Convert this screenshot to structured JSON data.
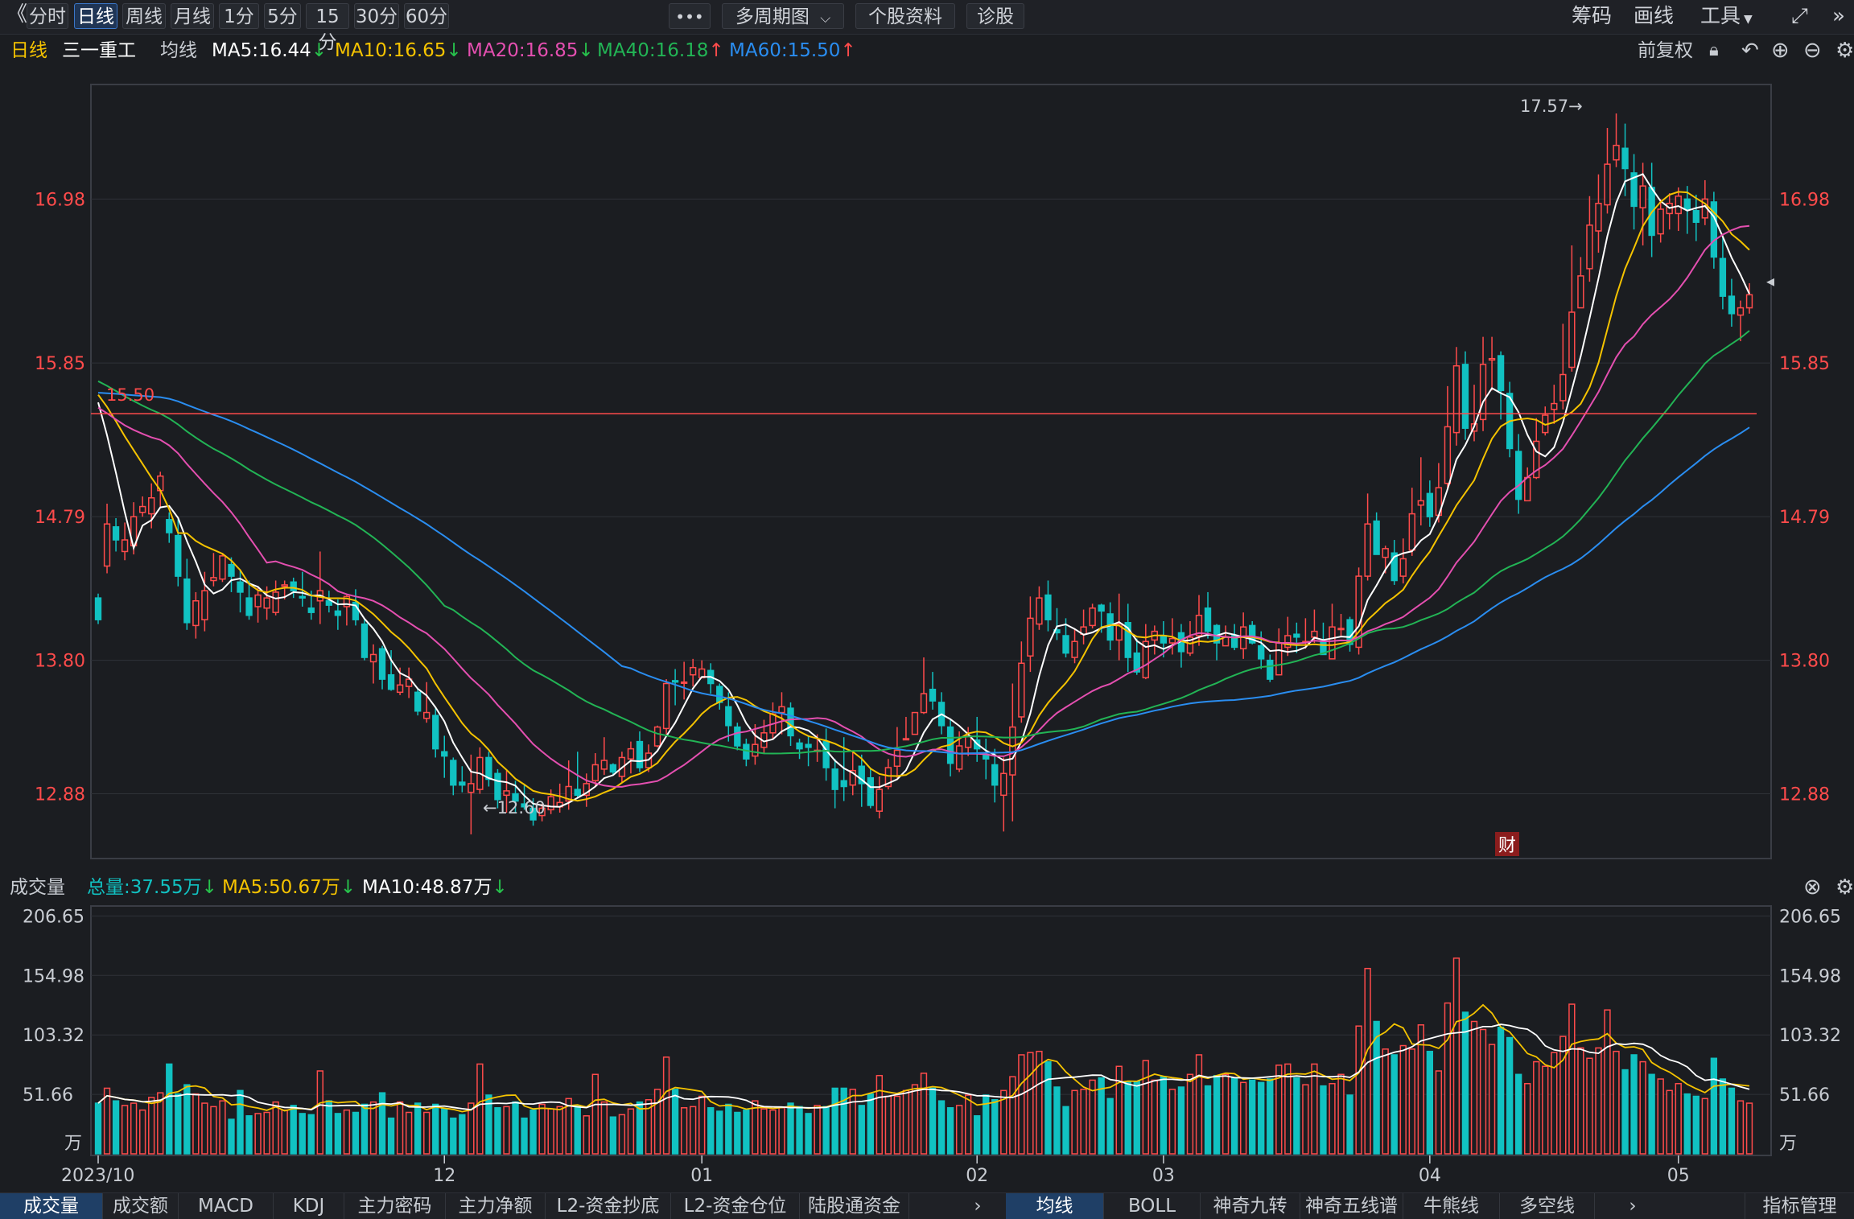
{
  "toolbar": {
    "back_glyph": "《",
    "periods": [
      "分时",
      "日线",
      "周线",
      "月线",
      "1分",
      "5分",
      "15分",
      "30分",
      "60分"
    ],
    "active_period": 1,
    "more_label": "•••",
    "multi_period_label": "多周期图",
    "stock_info_label": "个股资料",
    "diagnose_label": "诊股",
    "right_links": [
      "筹码",
      "画线",
      "工具"
    ]
  },
  "ma_bar": {
    "period_label": "日线",
    "stock_name": "三一重工",
    "avg_label": "均线",
    "items": [
      {
        "text": "MA5:16.44",
        "arrow": "↓",
        "color": "#ffffff",
        "arrow_color": "#27c24c"
      },
      {
        "text": "MA10:16.65",
        "arrow": "↓",
        "color": "#f5c300",
        "arrow_color": "#27c24c"
      },
      {
        "text": "MA20:16.85",
        "arrow": "↓",
        "color": "#e44fb0",
        "arrow_color": "#27c24c"
      },
      {
        "text": "MA40:16.18",
        "arrow": "↑",
        "color": "#22b455",
        "arrow_color": "#ff4b4b"
      },
      {
        "text": "MA60:15.50",
        "arrow": "↑",
        "color": "#2a8df0",
        "arrow_color": "#ff4b4b"
      }
    ],
    "adjust_label": "前复权"
  },
  "price_chart": {
    "y_ticks": [
      "16.98",
      "15.85",
      "14.79",
      "13.80",
      "12.88"
    ],
    "hline_label": "15.50",
    "high_label": "17.57→",
    "low_label": "←12.60",
    "cai_badge": "财"
  },
  "volume_bar": {
    "title": "成交量",
    "total": "总量:37.55万",
    "ma5": "MA5:50.67万",
    "ma10": "MA10:48.87万",
    "y_ticks": [
      "206.65",
      "154.98",
      "103.32",
      "51.66"
    ],
    "unit": "万"
  },
  "x_labels": [
    "2023/10",
    "12",
    "01",
    "02",
    "03",
    "04",
    "05"
  ],
  "bottom_tabs_left": [
    "成交量",
    "成交额",
    "MACD",
    "KDJ",
    "主力密码",
    "主力净额",
    "L2-资金抄底",
    "L2-资金仓位",
    "陆股通资金"
  ],
  "bottom_tabs_right": [
    "均线",
    "BOLL",
    "神奇九转",
    "神奇五线谱",
    "牛熊线",
    "多空线"
  ],
  "indicator_manage": "指标管理",
  "colors": {
    "up": "#ff4b4b",
    "down": "#11c2c2",
    "ma5": "#ffffff",
    "ma10": "#f5c300",
    "ma20": "#e44fb0",
    "ma40": "#22b455",
    "ma60": "#2a8df0"
  },
  "chart_data": {
    "type": "candlestick",
    "price_ylim": [
      12.0,
      17.95
    ],
    "volume_ylim": [
      0,
      216
    ],
    "reference_line": 15.5,
    "candles": [
      [
        14.23,
        14.08,
        14.26,
        14.05,
        44
      ],
      [
        14.45,
        14.74,
        14.88,
        14.4,
        57
      ],
      [
        14.72,
        14.63,
        14.78,
        14.55,
        46
      ],
      [
        14.55,
        14.63,
        14.75,
        14.49,
        42
      ],
      [
        14.59,
        14.79,
        14.89,
        14.53,
        44
      ],
      [
        14.82,
        14.86,
        14.93,
        14.79,
        38
      ],
      [
        14.81,
        14.92,
        15.02,
        14.71,
        49
      ],
      [
        14.97,
        15.07,
        15.1,
        14.86,
        53
      ],
      [
        14.77,
        14.68,
        14.82,
        14.61,
        78
      ],
      [
        14.66,
        14.38,
        14.78,
        14.31,
        52
      ],
      [
        14.36,
        14.06,
        14.5,
        14.01,
        60
      ],
      [
        14.04,
        14.21,
        14.27,
        13.95,
        52
      ],
      [
        14.08,
        14.28,
        14.41,
        14.0,
        44
      ],
      [
        14.35,
        14.37,
        14.54,
        14.31,
        41
      ],
      [
        14.36,
        14.52,
        14.54,
        14.34,
        46
      ],
      [
        14.46,
        14.38,
        14.51,
        14.27,
        30
      ],
      [
        14.34,
        14.27,
        14.42,
        14.13,
        55
      ],
      [
        14.23,
        14.11,
        14.35,
        14.08,
        33
      ],
      [
        14.17,
        14.25,
        14.31,
        14.06,
        35
      ],
      [
        14.16,
        14.23,
        14.31,
        14.08,
        36
      ],
      [
        14.13,
        14.27,
        14.35,
        14.11,
        45
      ],
      [
        14.31,
        14.32,
        14.35,
        14.22,
        38
      ],
      [
        14.34,
        14.28,
        14.37,
        14.23,
        42
      ],
      [
        14.24,
        14.23,
        14.41,
        14.17,
        35
      ],
      [
        14.16,
        14.13,
        14.28,
        14.08,
        34
      ],
      [
        14.21,
        14.28,
        14.55,
        14.05,
        72
      ],
      [
        14.21,
        14.18,
        14.28,
        14.13,
        46
      ],
      [
        14.14,
        14.11,
        14.22,
        14.01,
        35
      ],
      [
        14.17,
        14.24,
        14.25,
        14.04,
        38
      ],
      [
        14.2,
        14.08,
        14.29,
        14.04,
        36
      ],
      [
        14.05,
        13.82,
        14.08,
        13.8,
        43
      ],
      [
        13.79,
        13.84,
        13.91,
        13.64,
        45
      ],
      [
        13.88,
        13.67,
        13.9,
        13.6,
        53
      ],
      [
        13.7,
        13.6,
        13.87,
        13.59,
        31
      ],
      [
        13.58,
        13.63,
        13.75,
        13.56,
        45
      ],
      [
        13.62,
        13.67,
        13.75,
        13.54,
        36
      ],
      [
        13.58,
        13.45,
        13.61,
        13.42,
        44
      ],
      [
        13.4,
        13.44,
        13.65,
        13.37,
        36
      ],
      [
        13.42,
        13.19,
        13.47,
        13.13,
        43
      ],
      [
        13.17,
        13.14,
        13.28,
        12.99,
        39
      ],
      [
        13.11,
        12.94,
        13.13,
        12.87,
        31
      ],
      [
        12.96,
        12.94,
        13.07,
        12.89,
        34
      ],
      [
        12.89,
        12.95,
        13.15,
        12.6,
        44
      ],
      [
        12.91,
        13.13,
        13.2,
        12.88,
        78
      ],
      [
        13.13,
        12.98,
        13.17,
        12.93,
        51
      ],
      [
        13.02,
        12.84,
        13.05,
        12.78,
        40
      ],
      [
        12.87,
        12.9,
        13.04,
        12.75,
        41
      ],
      [
        12.88,
        12.83,
        12.97,
        12.75,
        45
      ],
      [
        12.81,
        12.79,
        12.94,
        12.77,
        31
      ],
      [
        12.78,
        12.7,
        12.85,
        12.66,
        38
      ],
      [
        12.73,
        12.78,
        12.81,
        12.69,
        43
      ],
      [
        12.77,
        12.86,
        12.91,
        12.74,
        39
      ],
      [
        12.79,
        12.82,
        12.95,
        12.75,
        41
      ],
      [
        12.83,
        12.93,
        13.11,
        12.77,
        48
      ],
      [
        12.91,
        12.87,
        13.17,
        12.85,
        42
      ],
      [
        12.87,
        12.95,
        13.02,
        12.79,
        33
      ],
      [
        12.97,
        13.08,
        13.16,
        12.93,
        69
      ],
      [
        13.05,
        13.11,
        13.27,
        13.01,
        45
      ],
      [
        13.08,
        13.03,
        13.09,
        13.01,
        32
      ],
      [
        13.0,
        13.13,
        13.17,
        12.96,
        34
      ],
      [
        13.12,
        13.19,
        13.24,
        13.02,
        39
      ],
      [
        13.24,
        13.06,
        13.31,
        13.03,
        45
      ],
      [
        13.06,
        13.16,
        13.22,
        13.03,
        47
      ],
      [
        13.21,
        13.34,
        13.35,
        13.2,
        56
      ],
      [
        13.33,
        13.64,
        13.67,
        13.29,
        84
      ],
      [
        13.66,
        13.65,
        13.74,
        13.49,
        56
      ],
      [
        13.65,
        13.65,
        13.79,
        13.53,
        40
      ],
      [
        13.7,
        13.75,
        13.81,
        13.62,
        41
      ],
      [
        13.68,
        13.74,
        13.8,
        13.69,
        50
      ],
      [
        13.73,
        13.64,
        13.78,
        13.57,
        40
      ],
      [
        13.62,
        13.51,
        13.64,
        13.46,
        37
      ],
      [
        13.48,
        13.35,
        13.58,
        13.24,
        43
      ],
      [
        13.34,
        13.21,
        13.37,
        13.18,
        36
      ],
      [
        13.22,
        13.12,
        13.26,
        13.07,
        38
      ],
      [
        13.14,
        13.22,
        13.36,
        13.08,
        46
      ],
      [
        13.2,
        13.3,
        13.39,
        13.16,
        39
      ],
      [
        13.3,
        13.43,
        13.51,
        13.26,
        38
      ],
      [
        13.44,
        13.48,
        13.58,
        13.29,
        40
      ],
      [
        13.47,
        13.28,
        13.51,
        13.21,
        44
      ],
      [
        13.23,
        13.19,
        13.26,
        13.12,
        41
      ],
      [
        13.22,
        13.2,
        13.28,
        13.07,
        35
      ],
      [
        13.18,
        13.18,
        13.29,
        13.1,
        42
      ],
      [
        13.24,
        13.06,
        13.33,
        12.97,
        41
      ],
      [
        13.05,
        12.91,
        13.12,
        12.78,
        57
      ],
      [
        12.97,
        12.93,
        13.27,
        12.83,
        57
      ],
      [
        12.94,
        13.04,
        13.17,
        12.87,
        56
      ],
      [
        13.07,
        12.95,
        13.15,
        12.79,
        42
      ],
      [
        12.99,
        12.8,
        13.06,
        12.78,
        52
      ],
      [
        12.76,
        12.91,
        13.0,
        12.71,
        68
      ],
      [
        12.93,
        13.06,
        13.12,
        12.91,
        50
      ],
      [
        13.07,
        13.18,
        13.34,
        12.99,
        50
      ],
      [
        13.26,
        13.26,
        13.41,
        13.26,
        55
      ],
      [
        13.29,
        13.44,
        13.43,
        13.29,
        60
      ],
      [
        13.44,
        13.57,
        13.82,
        13.43,
        70
      ],
      [
        13.6,
        13.52,
        13.72,
        13.46,
        57
      ],
      [
        13.51,
        13.35,
        13.58,
        13.29,
        46
      ],
      [
        13.34,
        13.09,
        13.39,
        13.0,
        40
      ],
      [
        13.05,
        13.21,
        13.31,
        13.03,
        42
      ],
      [
        13.2,
        13.28,
        13.34,
        13.14,
        51
      ],
      [
        13.25,
        13.19,
        13.41,
        13.1,
        33
      ],
      [
        13.15,
        13.12,
        13.26,
        12.98,
        51
      ],
      [
        13.08,
        12.94,
        13.19,
        12.82,
        47
      ],
      [
        12.87,
        13.02,
        13.13,
        12.62,
        55
      ],
      [
        13.01,
        13.34,
        13.64,
        12.69,
        67
      ],
      [
        13.41,
        13.78,
        13.93,
        13.37,
        86
      ],
      [
        13.83,
        14.09,
        14.24,
        13.72,
        88
      ],
      [
        14.05,
        14.23,
        14.31,
        14.01,
        89
      ],
      [
        14.25,
        14.08,
        14.35,
        14.0,
        80
      ],
      [
        14.01,
        13.99,
        14.16,
        13.94,
        58
      ],
      [
        13.97,
        13.85,
        14.09,
        13.82,
        41
      ],
      [
        13.82,
        13.93,
        14.02,
        13.78,
        55
      ],
      [
        13.98,
        14.03,
        14.15,
        13.91,
        56
      ],
      [
        14.04,
        14.16,
        14.19,
        14.02,
        64
      ],
      [
        14.18,
        14.14,
        14.19,
        13.99,
        66
      ],
      [
        14.12,
        13.94,
        14.2,
        13.87,
        48
      ],
      [
        13.94,
        14.05,
        14.26,
        13.8,
        76
      ],
      [
        14.06,
        13.82,
        14.19,
        13.72,
        62
      ],
      [
        13.85,
        13.72,
        13.95,
        13.7,
        63
      ],
      [
        13.68,
        13.93,
        14.05,
        13.67,
        81
      ],
      [
        13.94,
        14.0,
        14.04,
        13.84,
        64
      ],
      [
        13.97,
        13.92,
        14.07,
        13.82,
        67
      ],
      [
        13.92,
        13.95,
        14.09,
        13.84,
        56
      ],
      [
        13.99,
        13.86,
        14.05,
        13.75,
        58
      ],
      [
        13.85,
        13.96,
        14.07,
        13.83,
        69
      ],
      [
        13.97,
        14.11,
        14.25,
        13.9,
        86
      ],
      [
        14.16,
        14.0,
        14.27,
        13.95,
        59
      ],
      [
        14.04,
        13.92,
        14.05,
        13.8,
        68
      ],
      [
        13.9,
        13.96,
        14.04,
        13.92,
        69
      ],
      [
        13.97,
        13.89,
        14.05,
        13.87,
        66
      ],
      [
        13.88,
        14.03,
        14.13,
        13.81,
        62
      ],
      [
        14.04,
        13.92,
        14.07,
        13.91,
        64
      ],
      [
        13.9,
        13.81,
        14.0,
        13.74,
        62
      ],
      [
        13.8,
        13.67,
        13.84,
        13.65,
        65
      ],
      [
        13.7,
        13.92,
        14.02,
        13.72,
        77
      ],
      [
        13.89,
        13.97,
        14.1,
        13.83,
        78
      ],
      [
        13.98,
        13.96,
        14.06,
        13.85,
        66
      ],
      [
        13.93,
        13.93,
        14.09,
        13.88,
        60
      ],
      [
        13.96,
        14.0,
        14.15,
        13.92,
        78
      ],
      [
        13.93,
        13.84,
        14.06,
        13.85,
        59
      ],
      [
        13.81,
        14.03,
        14.19,
        13.86,
        61
      ],
      [
        14.02,
        14.02,
        14.12,
        13.97,
        69
      ],
      [
        14.08,
        13.91,
        14.1,
        13.86,
        51
      ],
      [
        13.89,
        14.38,
        14.44,
        13.84,
        111
      ],
      [
        14.38,
        14.74,
        14.95,
        14.35,
        161
      ],
      [
        14.76,
        14.53,
        14.82,
        14.53,
        115
      ],
      [
        14.51,
        14.57,
        14.59,
        14.4,
        91
      ],
      [
        14.54,
        14.35,
        14.63,
        14.32,
        86
      ],
      [
        14.38,
        14.5,
        14.64,
        14.33,
        94
      ],
      [
        14.56,
        14.81,
        14.99,
        14.52,
        91
      ],
      [
        14.87,
        14.9,
        15.2,
        14.73,
        112
      ],
      [
        14.95,
        14.79,
        15.04,
        14.72,
        89
      ],
      [
        14.8,
        14.99,
        15.16,
        14.75,
        72
      ],
      [
        15.02,
        15.41,
        15.69,
        14.98,
        131
      ],
      [
        15.37,
        15.83,
        15.96,
        15.28,
        170
      ],
      [
        15.84,
        15.4,
        15.93,
        15.32,
        123
      ],
      [
        15.38,
        15.43,
        15.7,
        15.31,
        115
      ],
      [
        15.46,
        15.84,
        16.03,
        15.38,
        108
      ],
      [
        15.87,
        15.88,
        16.03,
        15.66,
        95
      ],
      [
        15.9,
        15.66,
        15.93,
        15.46,
        110
      ],
      [
        15.64,
        15.26,
        15.72,
        15.2,
        101
      ],
      [
        15.24,
        14.91,
        15.36,
        14.81,
        69
      ],
      [
        14.9,
        15.06,
        15.13,
        14.96,
        61
      ],
      [
        15.06,
        15.31,
        15.47,
        15.05,
        80
      ],
      [
        15.37,
        15.49,
        15.55,
        15.35,
        76
      ],
      [
        15.53,
        15.57,
        15.7,
        15.43,
        88
      ],
      [
        15.59,
        15.77,
        16.12,
        15.53,
        102
      ],
      [
        15.82,
        16.2,
        16.66,
        15.79,
        130
      ],
      [
        16.23,
        16.45,
        16.58,
        16.23,
        92
      ],
      [
        16.5,
        16.8,
        17.0,
        16.41,
        83
      ],
      [
        16.76,
        16.95,
        17.15,
        16.61,
        92
      ],
      [
        16.94,
        17.22,
        17.47,
        16.88,
        125
      ],
      [
        17.25,
        17.35,
        17.57,
        17.2,
        89
      ],
      [
        17.33,
        17.19,
        17.5,
        17.0,
        73
      ],
      [
        17.16,
        16.93,
        17.29,
        16.77,
        86
      ],
      [
        16.92,
        17.07,
        17.23,
        16.66,
        80
      ],
      [
        17.06,
        16.73,
        17.23,
        16.58,
        69
      ],
      [
        16.74,
        16.91,
        16.98,
        16.68,
        65
      ],
      [
        16.88,
        16.95,
        17.02,
        16.77,
        55
      ],
      [
        16.88,
        17.0,
        17.06,
        16.76,
        61
      ],
      [
        16.98,
        16.91,
        17.07,
        16.74,
        52
      ],
      [
        16.9,
        16.82,
        17.01,
        16.69,
        50
      ],
      [
        16.85,
        16.98,
        17.11,
        16.8,
        48
      ],
      [
        16.96,
        16.58,
        17.03,
        16.5,
        83
      ],
      [
        16.57,
        16.31,
        16.74,
        16.22,
        65
      ],
      [
        16.31,
        16.19,
        16.43,
        16.1,
        57
      ],
      [
        16.18,
        16.23,
        16.28,
        16.0,
        46
      ],
      [
        16.23,
        16.32,
        16.4,
        16.19,
        44
      ]
    ]
  }
}
